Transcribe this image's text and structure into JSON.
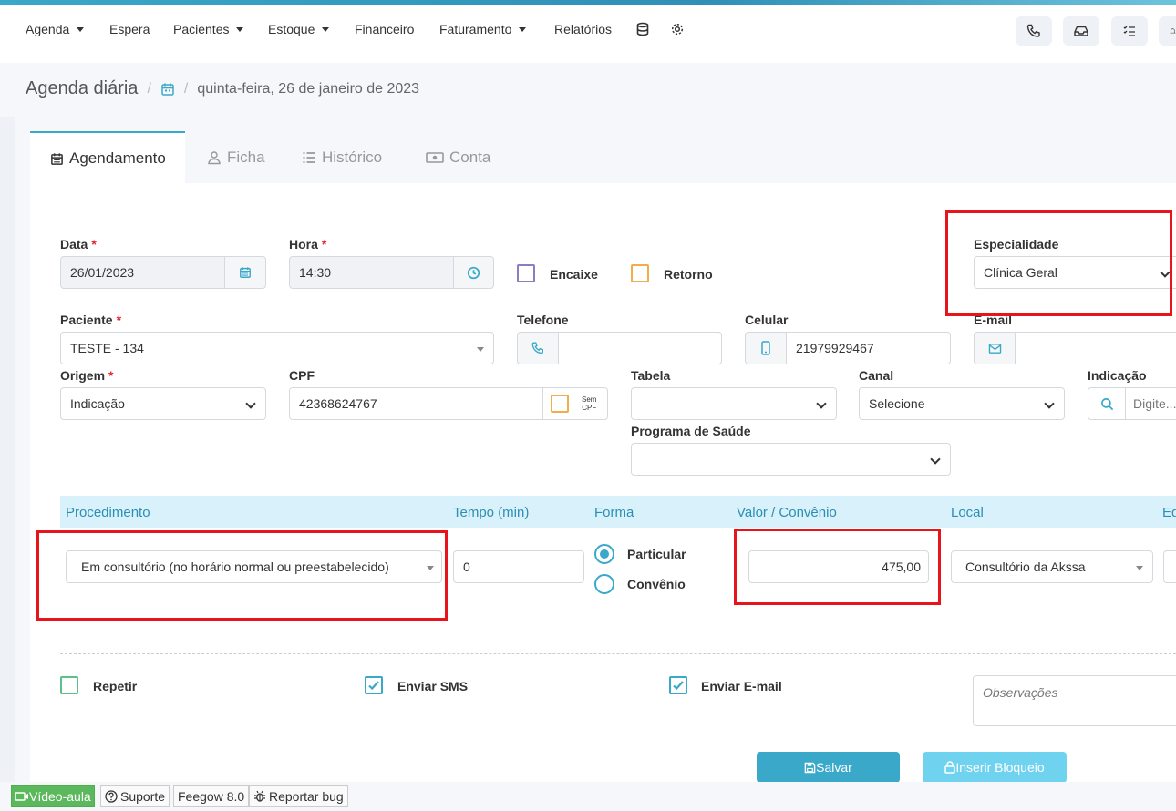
{
  "nav": {
    "items": [
      "Agenda",
      "Espera",
      "Pacientes",
      "Estoque",
      "Financeiro",
      "Faturamento",
      "Relatórios"
    ]
  },
  "breadcrumb": {
    "title": "Agenda diária",
    "separator": "/",
    "date": "quinta-feira, 26 de janeiro de 2023"
  },
  "tabs": [
    {
      "label": "Agendamento",
      "icon": "calendar-icon"
    },
    {
      "label": "Ficha",
      "icon": "user-icon"
    },
    {
      "label": "Histórico",
      "icon": "list-icon"
    },
    {
      "label": "Conta",
      "icon": "money-icon"
    }
  ],
  "form": {
    "data_label": "Data",
    "data_value": "26/01/2023",
    "hora_label": "Hora",
    "hora_value": "14:30",
    "encaixe_label": "Encaixe",
    "retorno_label": "Retorno",
    "especialidade_label": "Especialidade",
    "especialidade_value": "Clínica Geral",
    "paciente_label": "Paciente",
    "paciente_value": "TESTE - 134",
    "telefone_label": "Telefone",
    "telefone_value": "",
    "celular_label": "Celular",
    "celular_value": "21979929467",
    "email_label": "E-mail",
    "email_value": "",
    "origem_label": "Origem",
    "origem_value": "Indicação",
    "cpf_label": "CPF",
    "cpf_value": "42368624767",
    "sem_cpf_label_1": "Sem",
    "sem_cpf_label_2": "CPF",
    "tabela_label": "Tabela",
    "tabela_value": "",
    "canal_label": "Canal",
    "canal_value": "Selecione",
    "indicacao_label": "Indicação",
    "indicacao_placeholder": "Digite...",
    "programa_label": "Programa de Saúde",
    "programa_value": "",
    "required_mark": "*"
  },
  "procedure": {
    "headers": [
      "Procedimento",
      "Tempo (min)",
      "Forma",
      "Valor / Convênio",
      "Local",
      "Eq"
    ],
    "procedimento_value": "Em consultório (no horário normal ou preestabelecido)",
    "tempo_value": "0",
    "forma_options": [
      "Particular",
      "Convênio"
    ],
    "forma_selected": "Particular",
    "valor_value": "475,00",
    "local_value": "Consultório da Akssa"
  },
  "options": {
    "repetir_label": "Repetir",
    "repetir_checked": false,
    "sms_label": "Enviar SMS",
    "sms_checked": true,
    "email_label": "Enviar E-mail",
    "email_checked": true,
    "observacoes_placeholder": "Observações"
  },
  "buttons": {
    "salvar": "Salvar",
    "inserir_bloqueio": "Inserir Bloqueio"
  },
  "footer": {
    "video_aula": "Vídeo-aula",
    "suporte": "Suporte",
    "version": "Feegow 8.0",
    "reportar_bug": "Reportar bug"
  },
  "colors": {
    "accent": "#3aa8c9",
    "required": "#e0282d",
    "highlight_box": "#e8141b",
    "encaixe_border": "#8e7cc3",
    "retorno_border": "#f0ad4e",
    "repetir_border": "#5cc08a",
    "video_aula_bg": "#5cb85c"
  }
}
